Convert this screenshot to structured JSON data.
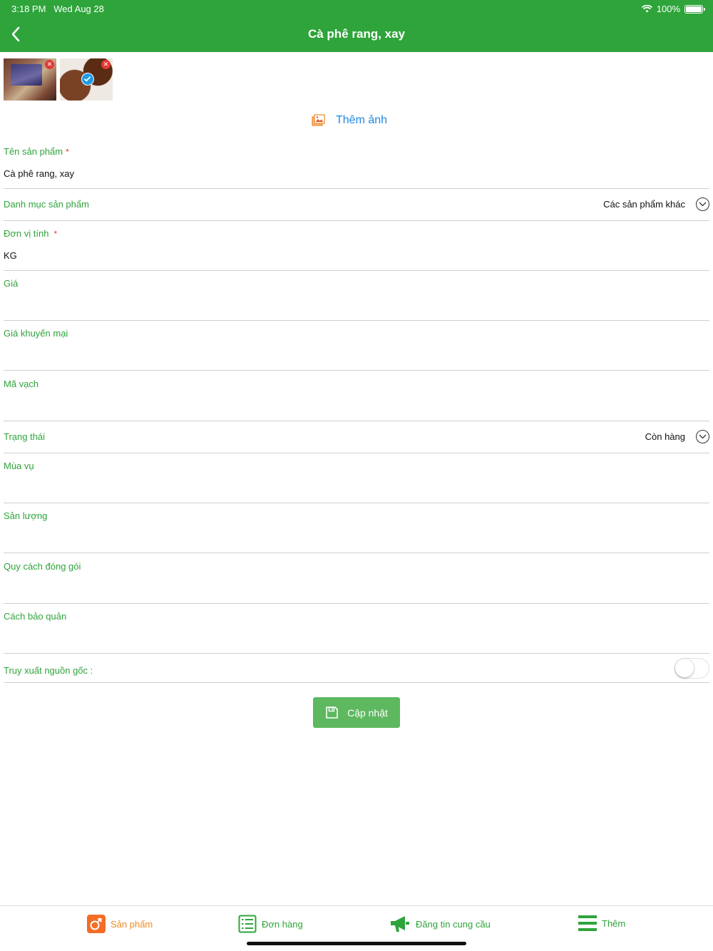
{
  "status": {
    "time": "3:18 PM",
    "date": "Wed Aug 28",
    "battery": "100%"
  },
  "header": {
    "title": "Cà phê rang, xay"
  },
  "photos": {
    "add_label": "Thêm ảnh"
  },
  "form": {
    "product_name": {
      "label": "Tên sản phẩm",
      "required": "*",
      "value": "Cà phê rang, xay"
    },
    "category": {
      "label": "Danh mục sản phẩm",
      "value": "Các sản phẩm khác"
    },
    "unit": {
      "label": "Đơn vị tính",
      "required": "*",
      "value": "KG"
    },
    "price": {
      "label": "Giá",
      "value": ""
    },
    "promo_price": {
      "label": "Giá khuyến mại",
      "value": ""
    },
    "barcode": {
      "label": "Mã vạch",
      "value": ""
    },
    "status": {
      "label": "Trạng thái",
      "value": "Còn hàng"
    },
    "season": {
      "label": "Mùa vụ",
      "value": ""
    },
    "yield": {
      "label": "Sản lượng",
      "value": ""
    },
    "packaging": {
      "label": "Quy cách đóng gói",
      "value": ""
    },
    "storage": {
      "label": "Cách bảo quản",
      "value": ""
    },
    "traceability": {
      "label": "Truy xuất nguồn gốc :",
      "enabled": false
    }
  },
  "actions": {
    "update_label": "Cập nhật"
  },
  "tabbar": {
    "items": [
      {
        "label": "Sản phẩm",
        "icon": "product-icon",
        "active": true
      },
      {
        "label": "Đơn hàng",
        "icon": "order-list-icon",
        "active": false
      },
      {
        "label": "Đăng tin cung cầu",
        "icon": "megaphone-icon",
        "active": false
      },
      {
        "label": "Thêm",
        "icon": "menu-icon",
        "active": false
      }
    ]
  },
  "colors": {
    "primary": "#2ea43a",
    "button": "#5db85f",
    "link": "#1e88e5",
    "required": "#e53935",
    "active_tab": "#f08a24"
  }
}
